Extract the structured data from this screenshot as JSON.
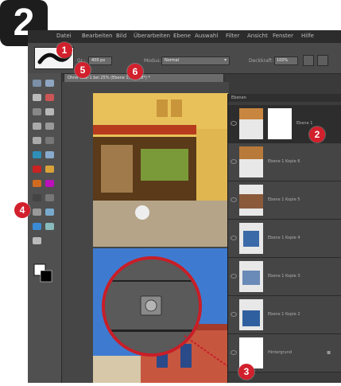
{
  "step": {
    "number": "2"
  },
  "menubar": {
    "items": [
      "Datei",
      "Bearbeiten",
      "Bild",
      "Überarbeiten",
      "Ebene",
      "Auswahl",
      "Filter",
      "Ansicht",
      "Fenster",
      "Hilfe"
    ]
  },
  "options_bar": {
    "size_label": "Gr.:",
    "size_value": "400 px",
    "mode_label": "Modus:",
    "mode_value": "Normal",
    "opacity_label": "Deckkraft:",
    "opacity_value": "100%"
  },
  "document": {
    "tab_title": "Ohne Titel-1 bei 25% (Ebene 1, RGB/8*) *"
  },
  "layers_panel": {
    "tab_label": "Ebenen",
    "rows": [
      {
        "name": "Ebene 1"
      },
      {
        "name": "Ebene 1 Kopie 6"
      },
      {
        "name": "Ebene 1 Kopie 5"
      },
      {
        "name": "Ebene 1 Kopie 4"
      },
      {
        "name": "Ebene 1 Kopie 3"
      },
      {
        "name": "Ebene 1 Kopie 2"
      },
      {
        "name": "Hintergrund"
      }
    ]
  },
  "annotations": {
    "b1": "1",
    "b2": "2",
    "b3": "3",
    "b4": "4",
    "b5": "5",
    "b6": "6"
  },
  "colors": {
    "accent_red": "#d2202c",
    "panel_dark": "#3a3a3a",
    "selected_row": "#2d2d2d"
  }
}
